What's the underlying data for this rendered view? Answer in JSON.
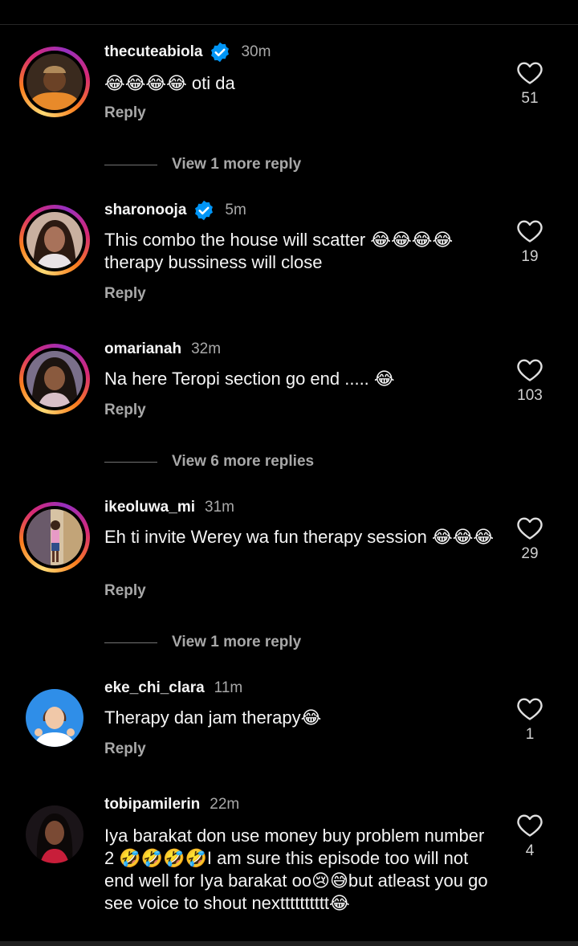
{
  "comments": [
    {
      "username": "thecuteabiola",
      "verified": true,
      "time": "30m",
      "text": "😂😂😂😂 oti da",
      "reply": "Reply",
      "likes": "51",
      "more_replies": "View 1 more reply"
    },
    {
      "username": "sharonooja",
      "verified": true,
      "time": "5m",
      "text": "This combo the house will scatter 😂😂😂😂 therapy bussiness will close",
      "reply": "Reply",
      "likes": "19"
    },
    {
      "username": "omarianah",
      "verified": false,
      "time": "32m",
      "text": "Na here Teropi section go end ..... 😂",
      "reply": "Reply",
      "likes": "103",
      "more_replies": "View 6 more replies"
    },
    {
      "username": "ikeoluwa_mi",
      "verified": false,
      "time": "31m",
      "text": "Eh ti invite Werey wa fun therapy session 😂😂😂",
      "reply": "Reply",
      "likes": "29",
      "more_replies": "View 1 more reply"
    },
    {
      "username": "eke_chi_clara",
      "verified": false,
      "time": "11m",
      "text": "Therapy dan jam therapy😂",
      "reply": "Reply",
      "likes": "1"
    },
    {
      "username": "tobipamilerin",
      "verified": false,
      "time": "22m",
      "text": "Iya barakat don use money buy problem number 2 🤣🤣🤣🤣I am sure this episode too will not end well for Iya barakat oo😢😅but atleast you go see voice to shout nextttttttttt😂",
      "likes": "4"
    }
  ],
  "colors": {
    "background": "#000000",
    "verified": "#0095f6",
    "secondary_text": "#a8a8a8"
  }
}
